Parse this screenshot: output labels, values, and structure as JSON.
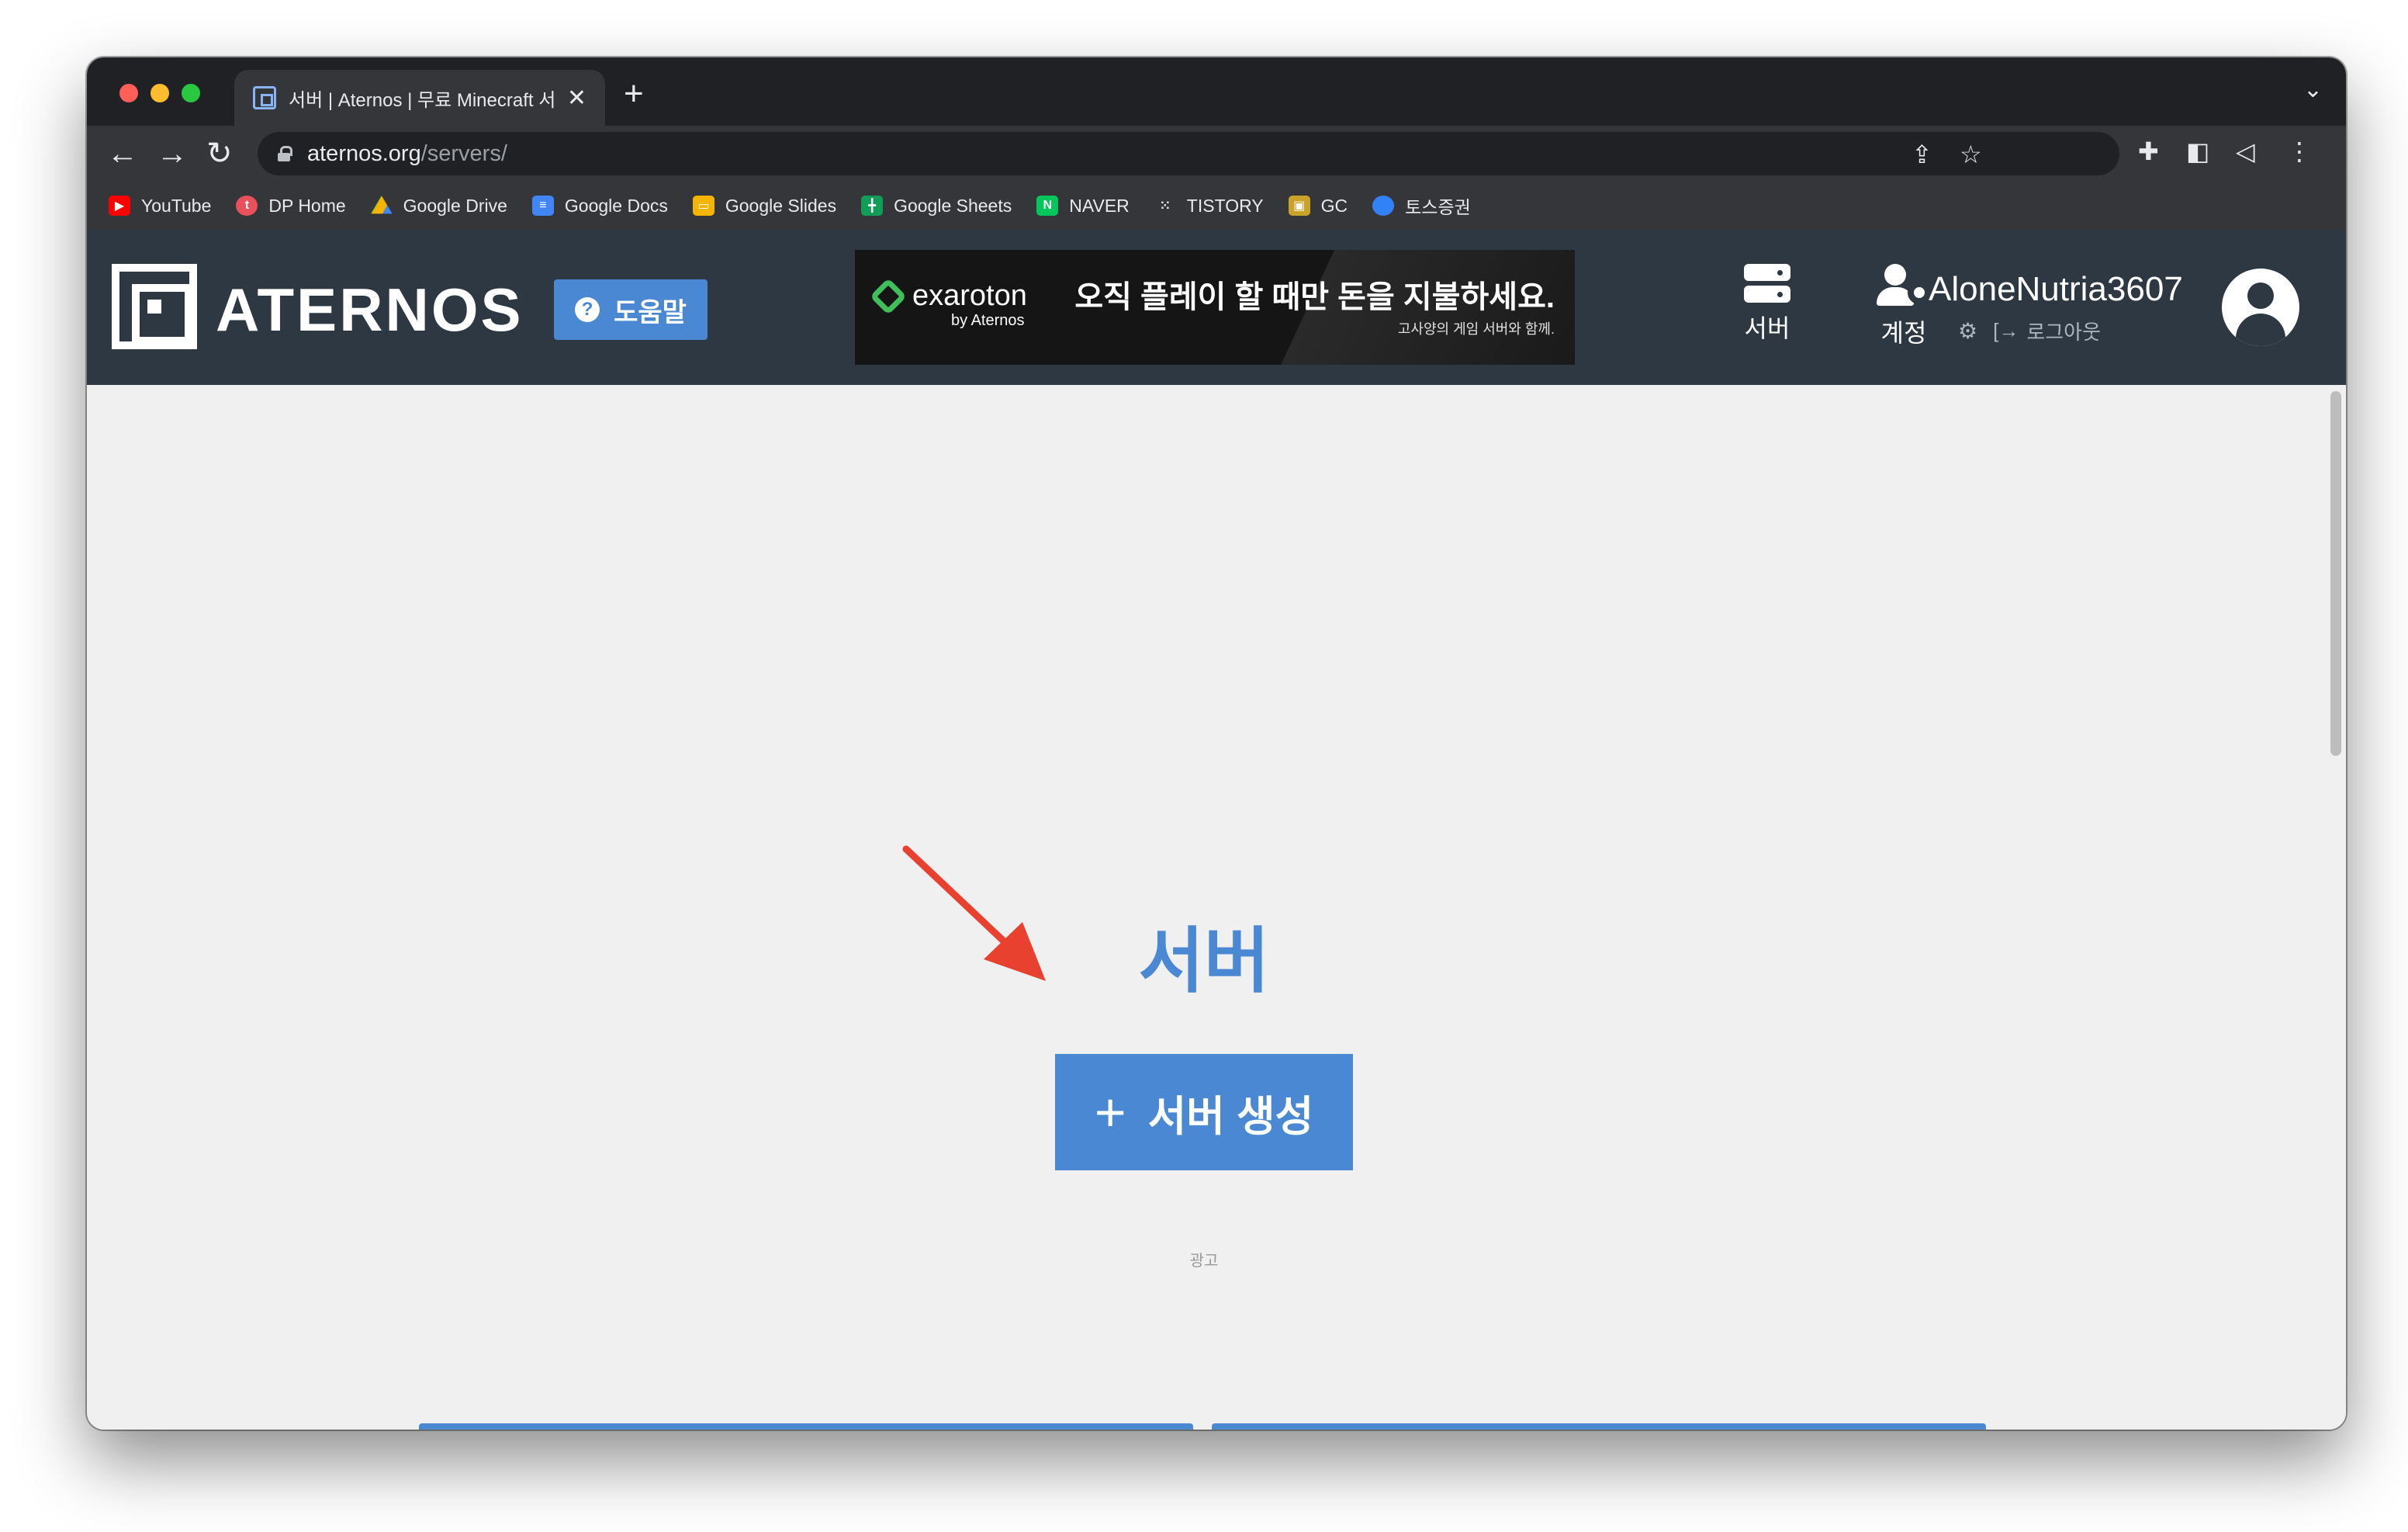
{
  "browser": {
    "tab_title": "서버 | Aternos | 무료 Minecraft 서",
    "tab_close": "✕",
    "new_tab": "+",
    "url_host": "aternos.org",
    "url_path": "/servers/",
    "bookmarks": [
      {
        "label": "YouTube",
        "icon": "youtube-icon",
        "color": "#ff0000"
      },
      {
        "label": "DP Home",
        "icon": "dp-home-icon",
        "color": "#e8505b"
      },
      {
        "label": "Google Drive",
        "icon": "google-drive-icon",
        "color": "#f4b400"
      },
      {
        "label": "Google Docs",
        "icon": "google-docs-icon",
        "color": "#4285f4"
      },
      {
        "label": "Google Slides",
        "icon": "google-slides-icon",
        "color": "#f4b400"
      },
      {
        "label": "Google Sheets",
        "icon": "google-sheets-icon",
        "color": "#0f9d58"
      },
      {
        "label": "NAVER",
        "icon": "naver-icon",
        "color": "#03c75a"
      },
      {
        "label": "TISTORY",
        "icon": "tistory-icon",
        "color": "#35363a"
      },
      {
        "label": "GC",
        "icon": "gc-icon",
        "color": "#c9a227"
      },
      {
        "label": "토스증권",
        "icon": "toss-icon",
        "color": "#3182f6"
      }
    ]
  },
  "header": {
    "logo_text": "ATERNOS",
    "help_label": "도움말",
    "help_icon_glyph": "?",
    "ad": {
      "brand": "exaroton",
      "brand_sub": "by Aternos",
      "headline": "오직 플레이 할 때만 돈을 지불하세요.",
      "subline": "고사양의 게임 서버와 함께."
    },
    "nav": {
      "servers_label": "서버",
      "account_label": "계정"
    },
    "username": "AloneNutria3607",
    "logout_label": "로그아웃"
  },
  "main": {
    "title": "서버",
    "create_button_label": "서버 생성",
    "create_button_icon": "+",
    "ad_label": "광고"
  },
  "colors": {
    "accent": "#4a88d4",
    "header_bg": "#2d3842",
    "page_bg": "#f0f0f0",
    "annotation_arrow": "#e8412f"
  }
}
